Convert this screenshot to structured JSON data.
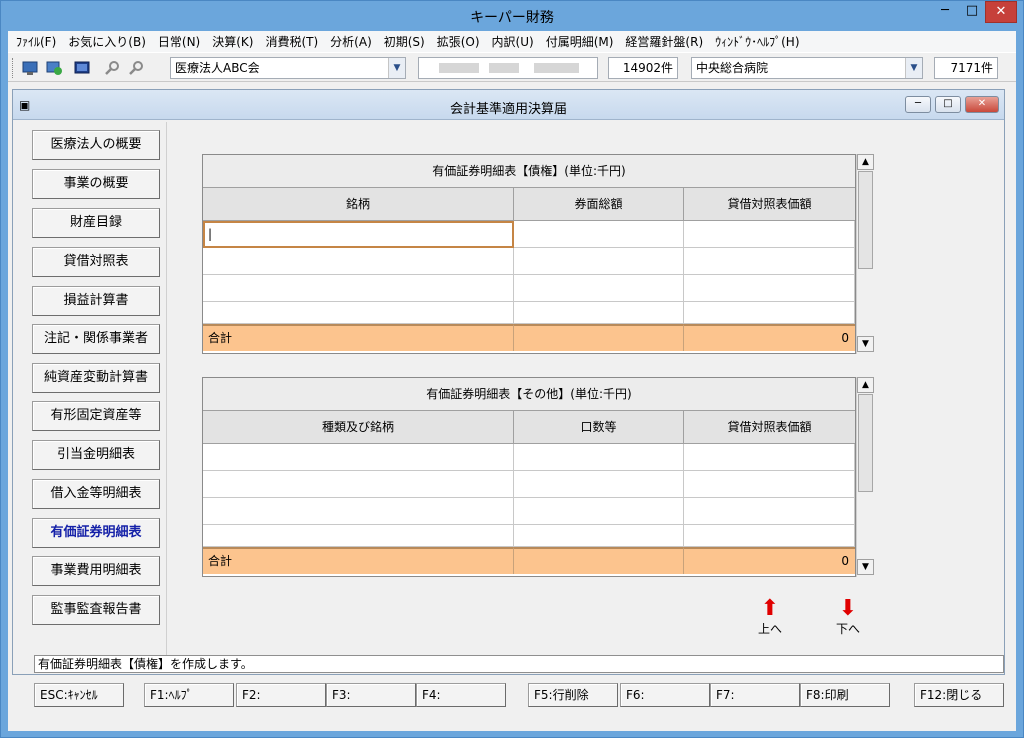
{
  "window": {
    "title": "キーパー財務",
    "min": "─",
    "max": "□",
    "close": "✕"
  },
  "menu": [
    "ﾌｧｲﾙ(F)",
    "お気に入り(B)",
    "日常(N)",
    "決算(K)",
    "消費税(T)",
    "分析(A)",
    "初期(S)",
    "拡張(O)",
    "内訳(U)",
    "付属明細(M)",
    "経営羅針盤(R)",
    "ｳｨﾝﾄﾞｳ･ﾍﾙﾌﾟ(H)"
  ],
  "toolbar": {
    "company": "医療法人ABC会",
    "company_count": "14902件",
    "facility": "中央総合病院",
    "facility_count": "7171件",
    "dropdown_glyph": "▼"
  },
  "child": {
    "title": "会計基準適用決算届",
    "icon": "▣",
    "min": "─",
    "max": "□",
    "close": "✕"
  },
  "sidebar": {
    "items": [
      "医療法人の概要",
      "事業の概要",
      "財産目録",
      "貸借対照表",
      "損益計算書",
      "注記・関係事業者",
      "純資産変動計算書",
      "有形固定資産等",
      "引当金明細表",
      "借入金等明細表",
      "有価証券明細表",
      "事業費用明細表",
      "監事監査報告書"
    ],
    "active_index": 10
  },
  "table1": {
    "caption": "有価証券明細表【債権】(単位:千円)",
    "headers": [
      "銘柄",
      "券面総額",
      "貸借対照表価額"
    ],
    "cursor": "|",
    "total_label": "合計",
    "total_value": "0"
  },
  "table2": {
    "caption": "有価証券明細表【その他】(単位:千円)",
    "headers": [
      "種類及び銘柄",
      "口数等",
      "貸借対照表価額"
    ],
    "total_label": "合計",
    "total_value": "0"
  },
  "scroll": {
    "up": "▲",
    "down": "▼"
  },
  "nav": {
    "up_label": "上へ",
    "down_label": "下へ",
    "up_glyph": "⬆",
    "down_glyph": "⬇"
  },
  "status": "有価証券明細表【債権】を作成します。",
  "fkeys": [
    "ESC:ｷｬﾝｾﾙ",
    "F1:ﾍﾙﾌﾟ",
    "F2:",
    "F3:",
    "F4:",
    "F5:行削除",
    "F6:",
    "F7:",
    "F8:印刷",
    "F12:閉じる"
  ]
}
